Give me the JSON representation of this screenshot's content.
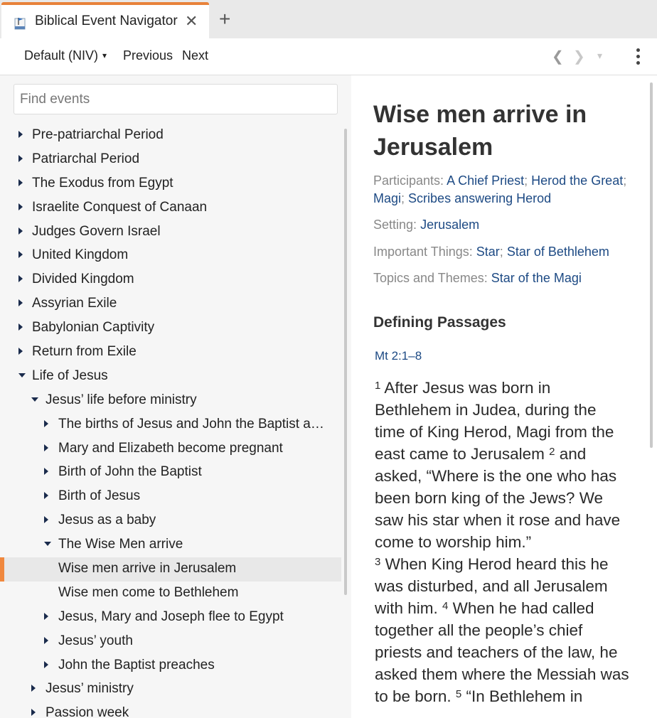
{
  "tab": {
    "title": "Biblical Event Navigator",
    "close": "✕",
    "new_tab": "+"
  },
  "toolbar": {
    "version": "Default (NIV)",
    "version_caret": "▾",
    "previous": "Previous",
    "next": "Next",
    "back": "❮",
    "forward": "❯",
    "history_caret": "▾"
  },
  "search": {
    "placeholder": "Find events",
    "value": ""
  },
  "tree": [
    {
      "label": "Pre-patriarchal Period",
      "level": 0,
      "state": "collapsed"
    },
    {
      "label": "Patriarchal Period",
      "level": 0,
      "state": "collapsed"
    },
    {
      "label": "The Exodus from Egypt",
      "level": 0,
      "state": "collapsed"
    },
    {
      "label": "Israelite Conquest of Canaan",
      "level": 0,
      "state": "collapsed"
    },
    {
      "label": "Judges Govern Israel",
      "level": 0,
      "state": "collapsed"
    },
    {
      "label": "United Kingdom",
      "level": 0,
      "state": "collapsed"
    },
    {
      "label": "Divided Kingdom",
      "level": 0,
      "state": "collapsed"
    },
    {
      "label": "Assyrian Exile",
      "level": 0,
      "state": "collapsed"
    },
    {
      "label": "Babylonian Captivity",
      "level": 0,
      "state": "collapsed"
    },
    {
      "label": "Return from Exile",
      "level": 0,
      "state": "collapsed"
    },
    {
      "label": "Life of Jesus",
      "level": 0,
      "state": "expanded"
    },
    {
      "label": "Jesus’ life before ministry",
      "level": 1,
      "state": "expanded"
    },
    {
      "label": "The births of Jesus and John the Baptist ar…",
      "level": 2,
      "state": "collapsed"
    },
    {
      "label": "Mary and Elizabeth become pregnant",
      "level": 2,
      "state": "collapsed"
    },
    {
      "label": "Birth of John the Baptist",
      "level": 2,
      "state": "collapsed"
    },
    {
      "label": "Birth of Jesus",
      "level": 2,
      "state": "collapsed"
    },
    {
      "label": "Jesus as a baby",
      "level": 2,
      "state": "collapsed"
    },
    {
      "label": "The Wise Men arrive",
      "level": 2,
      "state": "expanded"
    },
    {
      "label": "Wise men arrive in Jerusalem",
      "level": 3,
      "state": "leaf",
      "selected": true
    },
    {
      "label": "Wise men come to Bethlehem",
      "level": 3,
      "state": "leaf"
    },
    {
      "label": "Jesus, Mary and Joseph flee to Egypt",
      "level": 2,
      "state": "collapsed"
    },
    {
      "label": "Jesus’ youth",
      "level": 2,
      "state": "collapsed"
    },
    {
      "label": "John the Baptist preaches",
      "level": 2,
      "state": "collapsed"
    },
    {
      "label": "Jesus’ ministry",
      "level": 1,
      "state": "collapsed"
    },
    {
      "label": "Passion week",
      "level": 1,
      "state": "collapsed"
    }
  ],
  "event": {
    "title": "Wise men arrive in Jerusalem",
    "participants": {
      "label": "Participants:",
      "links": [
        "A Chief Priest",
        "Herod the Great",
        "Magi",
        "Scribes answering Herod"
      ]
    },
    "setting": {
      "label": "Setting:",
      "links": [
        "Jerusalem"
      ]
    },
    "important_things": {
      "label": "Important Things:",
      "links": [
        "Star",
        "Star of Bethlehem"
      ]
    },
    "topics": {
      "label": "Topics and Themes:",
      "links": [
        "Star of the Magi"
      ]
    },
    "defining_passages_heading": "Defining Passages",
    "reference": "Mt 2:1–8",
    "verses": [
      {
        "num": "1",
        "text": "After Jesus was born in Bethlehem in Judea, during the time of King Herod, Magi from the east came to Jerusalem"
      },
      {
        "num": "2",
        "text": "and asked, “Where is the one who has been born king of the Jews? We saw his star when it rose and have come to worship him.”"
      },
      {
        "num": "3",
        "text": "When King Herod heard this he was disturbed, and all Jerusalem with him."
      },
      {
        "num": "4",
        "text": "When he had called together all the people’s chief priests and teachers of the law, he asked them where the Messiah was to be born."
      },
      {
        "num": "5",
        "text": "“In Bethlehem in"
      }
    ]
  },
  "colors": {
    "accent": "#e8823a",
    "link": "#1d4a84",
    "tree_arrow": "#1a2b4c"
  }
}
